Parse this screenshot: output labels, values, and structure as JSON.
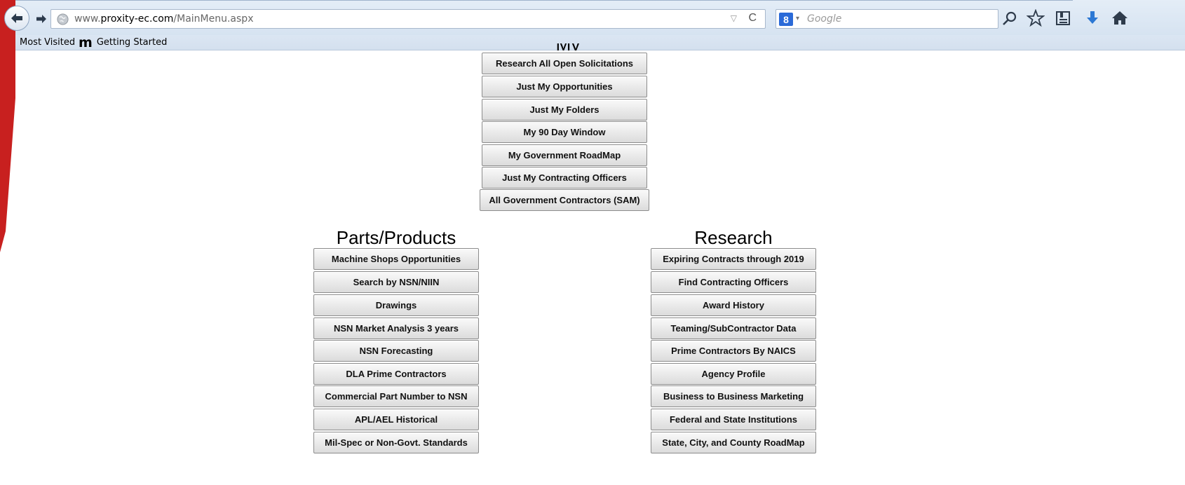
{
  "browser": {
    "url_prefix": "www.",
    "url_domain": "proxity-ec.com",
    "url_path": "/MainMenu.aspx",
    "search_engine_letter": "8",
    "search_placeholder": "Google"
  },
  "bookmarks": {
    "most_visited": "Most Visited",
    "getting_started_logo": "m",
    "getting_started": "Getting Started"
  },
  "page": {
    "top_section_heading_partial": "My",
    "top_buttons": [
      "Research All Open Solicitations",
      "Just My Opportunities",
      "Just My Folders",
      "My 90 Day Window",
      "My Government RoadMap",
      "Just My Contracting Officers",
      "All Government Contractors (SAM)"
    ],
    "parts": {
      "title": "Parts/Products",
      "buttons": [
        "Machine Shops Opportunities",
        "Search by NSN/NIIN",
        "Drawings",
        "NSN Market Analysis 3 years",
        "NSN Forecasting",
        "DLA Prime Contractors",
        "Commercial Part Number to NSN",
        "APL/AEL Historical",
        "Mil-Spec or Non-Govt. Standards"
      ]
    },
    "research": {
      "title": "Research",
      "buttons": [
        "Expiring Contracts through 2019",
        "Find Contracting Officers",
        "Award History",
        "Teaming/SubContractor Data",
        "Prime Contractors By NAICS",
        "Agency Profile",
        "Business to Business Marketing",
        "Federal and State Institutions",
        "State, City, and County RoadMap"
      ]
    }
  },
  "colors": {
    "accent_red": "#c8201f",
    "chrome_blue": "#d6e3f1",
    "button_border": "#8c8c8c"
  }
}
